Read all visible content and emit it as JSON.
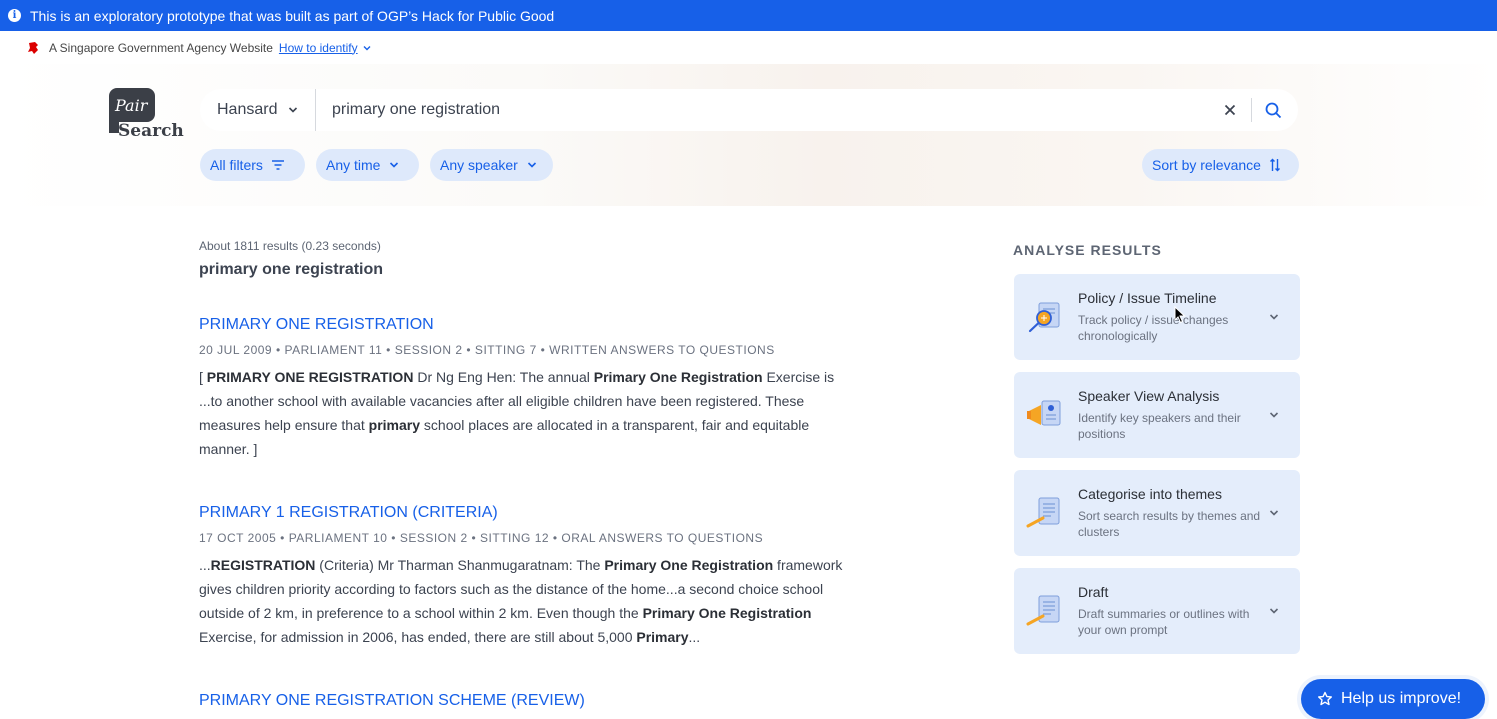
{
  "banner": {
    "text": "This is an exploratory prototype that was built as part of OGP’s Hack for Public Good",
    "info_icon": "info-icon"
  },
  "gov_bar": {
    "text": "A Singapore Government Agency Website",
    "identify_link": "How to identify"
  },
  "logo": {
    "pair": "Pair",
    "search": "Search"
  },
  "search": {
    "source": "Hansard",
    "query": "primary one registration"
  },
  "filters": {
    "all_filters": "All filters",
    "time": "Any time",
    "speaker": "Any speaker",
    "sort": "Sort by relevance"
  },
  "results_summary": {
    "meta": "About 1811 results (0.23 seconds)",
    "query": "primary one registration"
  },
  "results": [
    {
      "title": "PRIMARY ONE REGISTRATION",
      "meta": "20 JUL 2009 • PARLIAMENT 11 • SESSION 2 • SITTING 7 • WRITTEN ANSWERS TO QUESTIONS",
      "snippet_parts": [
        {
          "t": "[ ",
          "b": false
        },
        {
          "t": "PRIMARY ONE REGISTRATION",
          "b": true
        },
        {
          "t": " Dr Ng Eng Hen: The annual ",
          "b": false
        },
        {
          "t": "Primary One Registration",
          "b": true
        },
        {
          "t": " Exercise is ...to another school with available vacancies after all eligible children have been registered. These measures help ensure that ",
          "b": false
        },
        {
          "t": "primary",
          "b": true
        },
        {
          "t": " school places are allocated in a transparent, fair and equitable manner. ]",
          "b": false
        }
      ]
    },
    {
      "title": "PRIMARY 1 REGISTRATION (CRITERIA)",
      "meta": "17 OCT 2005 • PARLIAMENT 10 • SESSION 2 • SITTING 12 • ORAL ANSWERS TO QUESTIONS",
      "snippet_parts": [
        {
          "t": "...",
          "b": false
        },
        {
          "t": "REGISTRATION",
          "b": true
        },
        {
          "t": " (Criteria) Mr Tharman Shanmugaratnam: The ",
          "b": false
        },
        {
          "t": "Primary One Registration",
          "b": true
        },
        {
          "t": " framework gives children priority according to factors such as the distance of the home...a second choice school outside of 2 km, in preference to a school within 2 km. Even though the ",
          "b": false
        },
        {
          "t": "Primary One Registration",
          "b": true
        },
        {
          "t": " Exercise, for admission in 2006, has ended, there are still about 5,000 ",
          "b": false
        },
        {
          "t": "Primary",
          "b": true
        },
        {
          "t": "...",
          "b": false
        }
      ]
    },
    {
      "title": "PRIMARY ONE REGISTRATION SCHEME (REVIEW)"
    }
  ],
  "analyse": {
    "heading": "ANALYSE RESULTS",
    "cards": [
      {
        "title": "Policy / Issue Timeline",
        "desc": "Track policy / issue changes chronologically",
        "icon": "timeline-magnifier-icon"
      },
      {
        "title": "Speaker View Analysis",
        "desc": "Identify key speakers and their positions",
        "icon": "megaphone-document-icon"
      },
      {
        "title": "Categorise into themes",
        "desc": "Sort search results by themes and clusters",
        "icon": "document-pencil-icon"
      },
      {
        "title": "Draft",
        "desc": "Draft summaries or outlines with your own prompt",
        "icon": "draft-pencil-icon"
      }
    ]
  },
  "help": {
    "label": "Help us improve!",
    "icon": "star-icon"
  },
  "colors": {
    "primary": "#1760e8",
    "chip_bg": "#dee9fb",
    "card_bg": "#e4edfb",
    "text": "#3c4350"
  }
}
